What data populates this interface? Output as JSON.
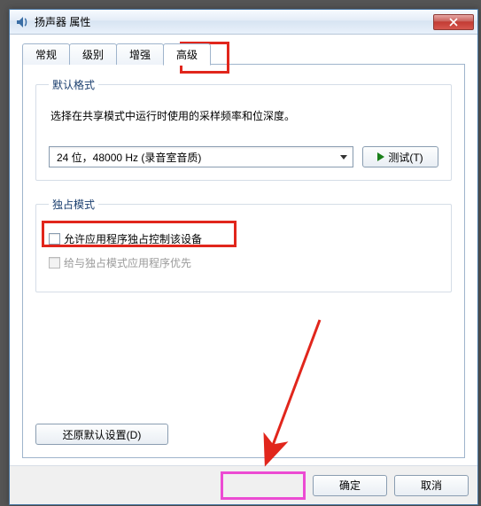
{
  "window": {
    "title": "扬声器 属性"
  },
  "tabs": {
    "general": "常规",
    "level": "级别",
    "enhance": "增强",
    "advanced": "高级"
  },
  "default_format": {
    "legend": "默认格式",
    "desc": "选择在共享模式中运行时使用的采样频率和位深度。",
    "selected": "24 位，48000 Hz (录音室音质)",
    "test_btn": "测试(T)"
  },
  "exclusive": {
    "legend": "独占模式",
    "opt_allow": "允许应用程序独占控制该设备",
    "opt_priority": "给与独占模式应用程序优先"
  },
  "restore_defaults": "还原默认设置(D)",
  "footer": {
    "ok": "确定",
    "cancel": "取消"
  }
}
